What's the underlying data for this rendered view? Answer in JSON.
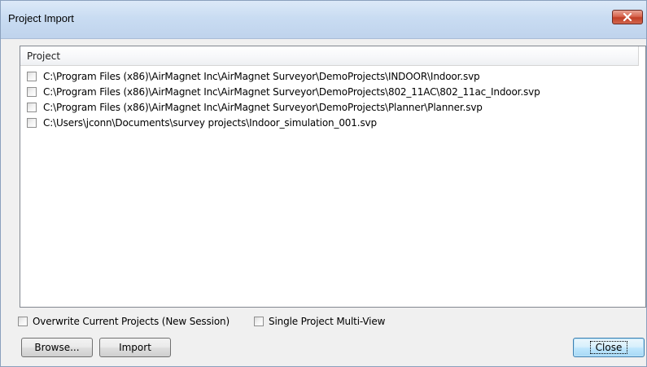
{
  "window": {
    "title": "Project Import"
  },
  "list": {
    "column_header": "Project",
    "items": [
      {
        "path": "C:\\Program Files (x86)\\AirMagnet Inc\\AirMagnet Surveyor\\DemoProjects\\INDOOR\\Indoor.svp",
        "checked": false
      },
      {
        "path": "C:\\Program Files (x86)\\AirMagnet Inc\\AirMagnet Surveyor\\DemoProjects\\802_11AC\\802_11ac_Indoor.svp",
        "checked": false
      },
      {
        "path": "C:\\Program Files (x86)\\AirMagnet Inc\\AirMagnet Surveyor\\DemoProjects\\Planner\\Planner.svp",
        "checked": false
      },
      {
        "path": "C:\\Users\\jconn\\Documents\\survey projects\\Indoor_simulation_001.svp",
        "checked": false
      }
    ]
  },
  "options": {
    "overwrite_label": "Overwrite Current Projects (New Session)",
    "overwrite_checked": false,
    "multiview_label": "Single Project Multi-View",
    "multiview_checked": false
  },
  "buttons": {
    "browse": "Browse...",
    "import": "Import",
    "close": "Close"
  },
  "colors": {
    "titlebar": "#c9dcf2",
    "close_button": "#c13f26",
    "default_button_border": "#3c7fb1"
  },
  "icons": {
    "title_close": "close-icon"
  }
}
